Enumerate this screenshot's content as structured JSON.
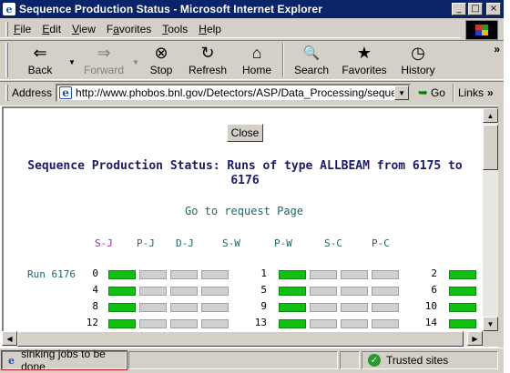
{
  "window": {
    "title": "Sequence Production Status - Microsoft Internet Explorer",
    "app_icon": "e",
    "controls": {
      "minimize": "_",
      "maximize": "□",
      "close": "×"
    }
  },
  "menu": [
    "File",
    "Edit",
    "View",
    "Favorites",
    "Tools",
    "Help"
  ],
  "menu_mnemonics": [
    "F",
    "E",
    "V",
    "a",
    "T",
    "H"
  ],
  "toolbar": {
    "buttons": [
      {
        "label": "Back",
        "icon": "back-arrow-icon",
        "glyph": "⇐",
        "enabled": true
      },
      {
        "label": "Forward",
        "icon": "forward-arrow-icon",
        "glyph": "⇒",
        "enabled": false
      },
      {
        "label": "Stop",
        "icon": "stop-icon",
        "glyph": "⊗",
        "enabled": true
      },
      {
        "label": "Refresh",
        "icon": "refresh-icon",
        "glyph": "↻",
        "enabled": true
      },
      {
        "label": "Home",
        "icon": "home-icon",
        "glyph": "⌂",
        "enabled": true
      },
      {
        "label": "Search",
        "icon": "search-icon",
        "glyph": "🔍",
        "enabled": true
      },
      {
        "label": "Favorites",
        "icon": "favorites-folder-icon",
        "glyph": "★",
        "enabled": true
      },
      {
        "label": "History",
        "icon": "history-icon",
        "glyph": "◷",
        "enabled": true
      }
    ],
    "more": "»"
  },
  "address": {
    "label": "Address",
    "url": "http://www.phobos.bnl.gov/Detectors/ASP/Data_Processing/sequence",
    "go_label": "Go",
    "links_label": "Links",
    "links_more": "»"
  },
  "page": {
    "close_button": "Close",
    "heading": "Sequence Production Status: Runs of type ALLBEAM from 6175 to 6176",
    "request_link": "Go to request Page",
    "columns": [
      "S-J",
      "P-J",
      "D-J",
      "S-W",
      "P-W",
      "S-C",
      "P-C"
    ],
    "run_label": "Run 6176",
    "groups": [
      {
        "rows": [
          {
            "num": "0",
            "status": [
              "done",
              "pending",
              "pending",
              "pending"
            ]
          },
          {
            "num": "4",
            "status": [
              "done",
              "pending",
              "pending",
              "pending"
            ]
          },
          {
            "num": "8",
            "status": [
              "done",
              "pending",
              "pending",
              "pending"
            ]
          },
          {
            "num": "12",
            "status": [
              "done",
              "pending",
              "pending",
              "pending"
            ]
          }
        ]
      },
      {
        "rows": [
          {
            "num": "1",
            "status": [
              "done",
              "pending",
              "pending",
              "pending"
            ]
          },
          {
            "num": "5",
            "status": [
              "done",
              "pending",
              "pending",
              "pending"
            ]
          },
          {
            "num": "9",
            "status": [
              "done",
              "pending",
              "pending",
              "pending"
            ]
          },
          {
            "num": "13",
            "status": [
              "done",
              "pending",
              "pending",
              "pending"
            ]
          }
        ]
      },
      {
        "rows": [
          {
            "num": "2",
            "status": [
              "done"
            ]
          },
          {
            "num": "6",
            "status": [
              "done"
            ]
          },
          {
            "num": "10",
            "status": [
              "done"
            ]
          },
          {
            "num": "14",
            "status": [
              "done"
            ]
          }
        ]
      }
    ],
    "colors": {
      "done": "#10c010",
      "pending": "#d0d0d0",
      "heading": "#1a1a6e",
      "link": "#1a6a6a",
      "first_column": "#b020b0"
    }
  },
  "status_bar": {
    "message": "sinking jobs to be done",
    "zone": "Trusted sites"
  }
}
